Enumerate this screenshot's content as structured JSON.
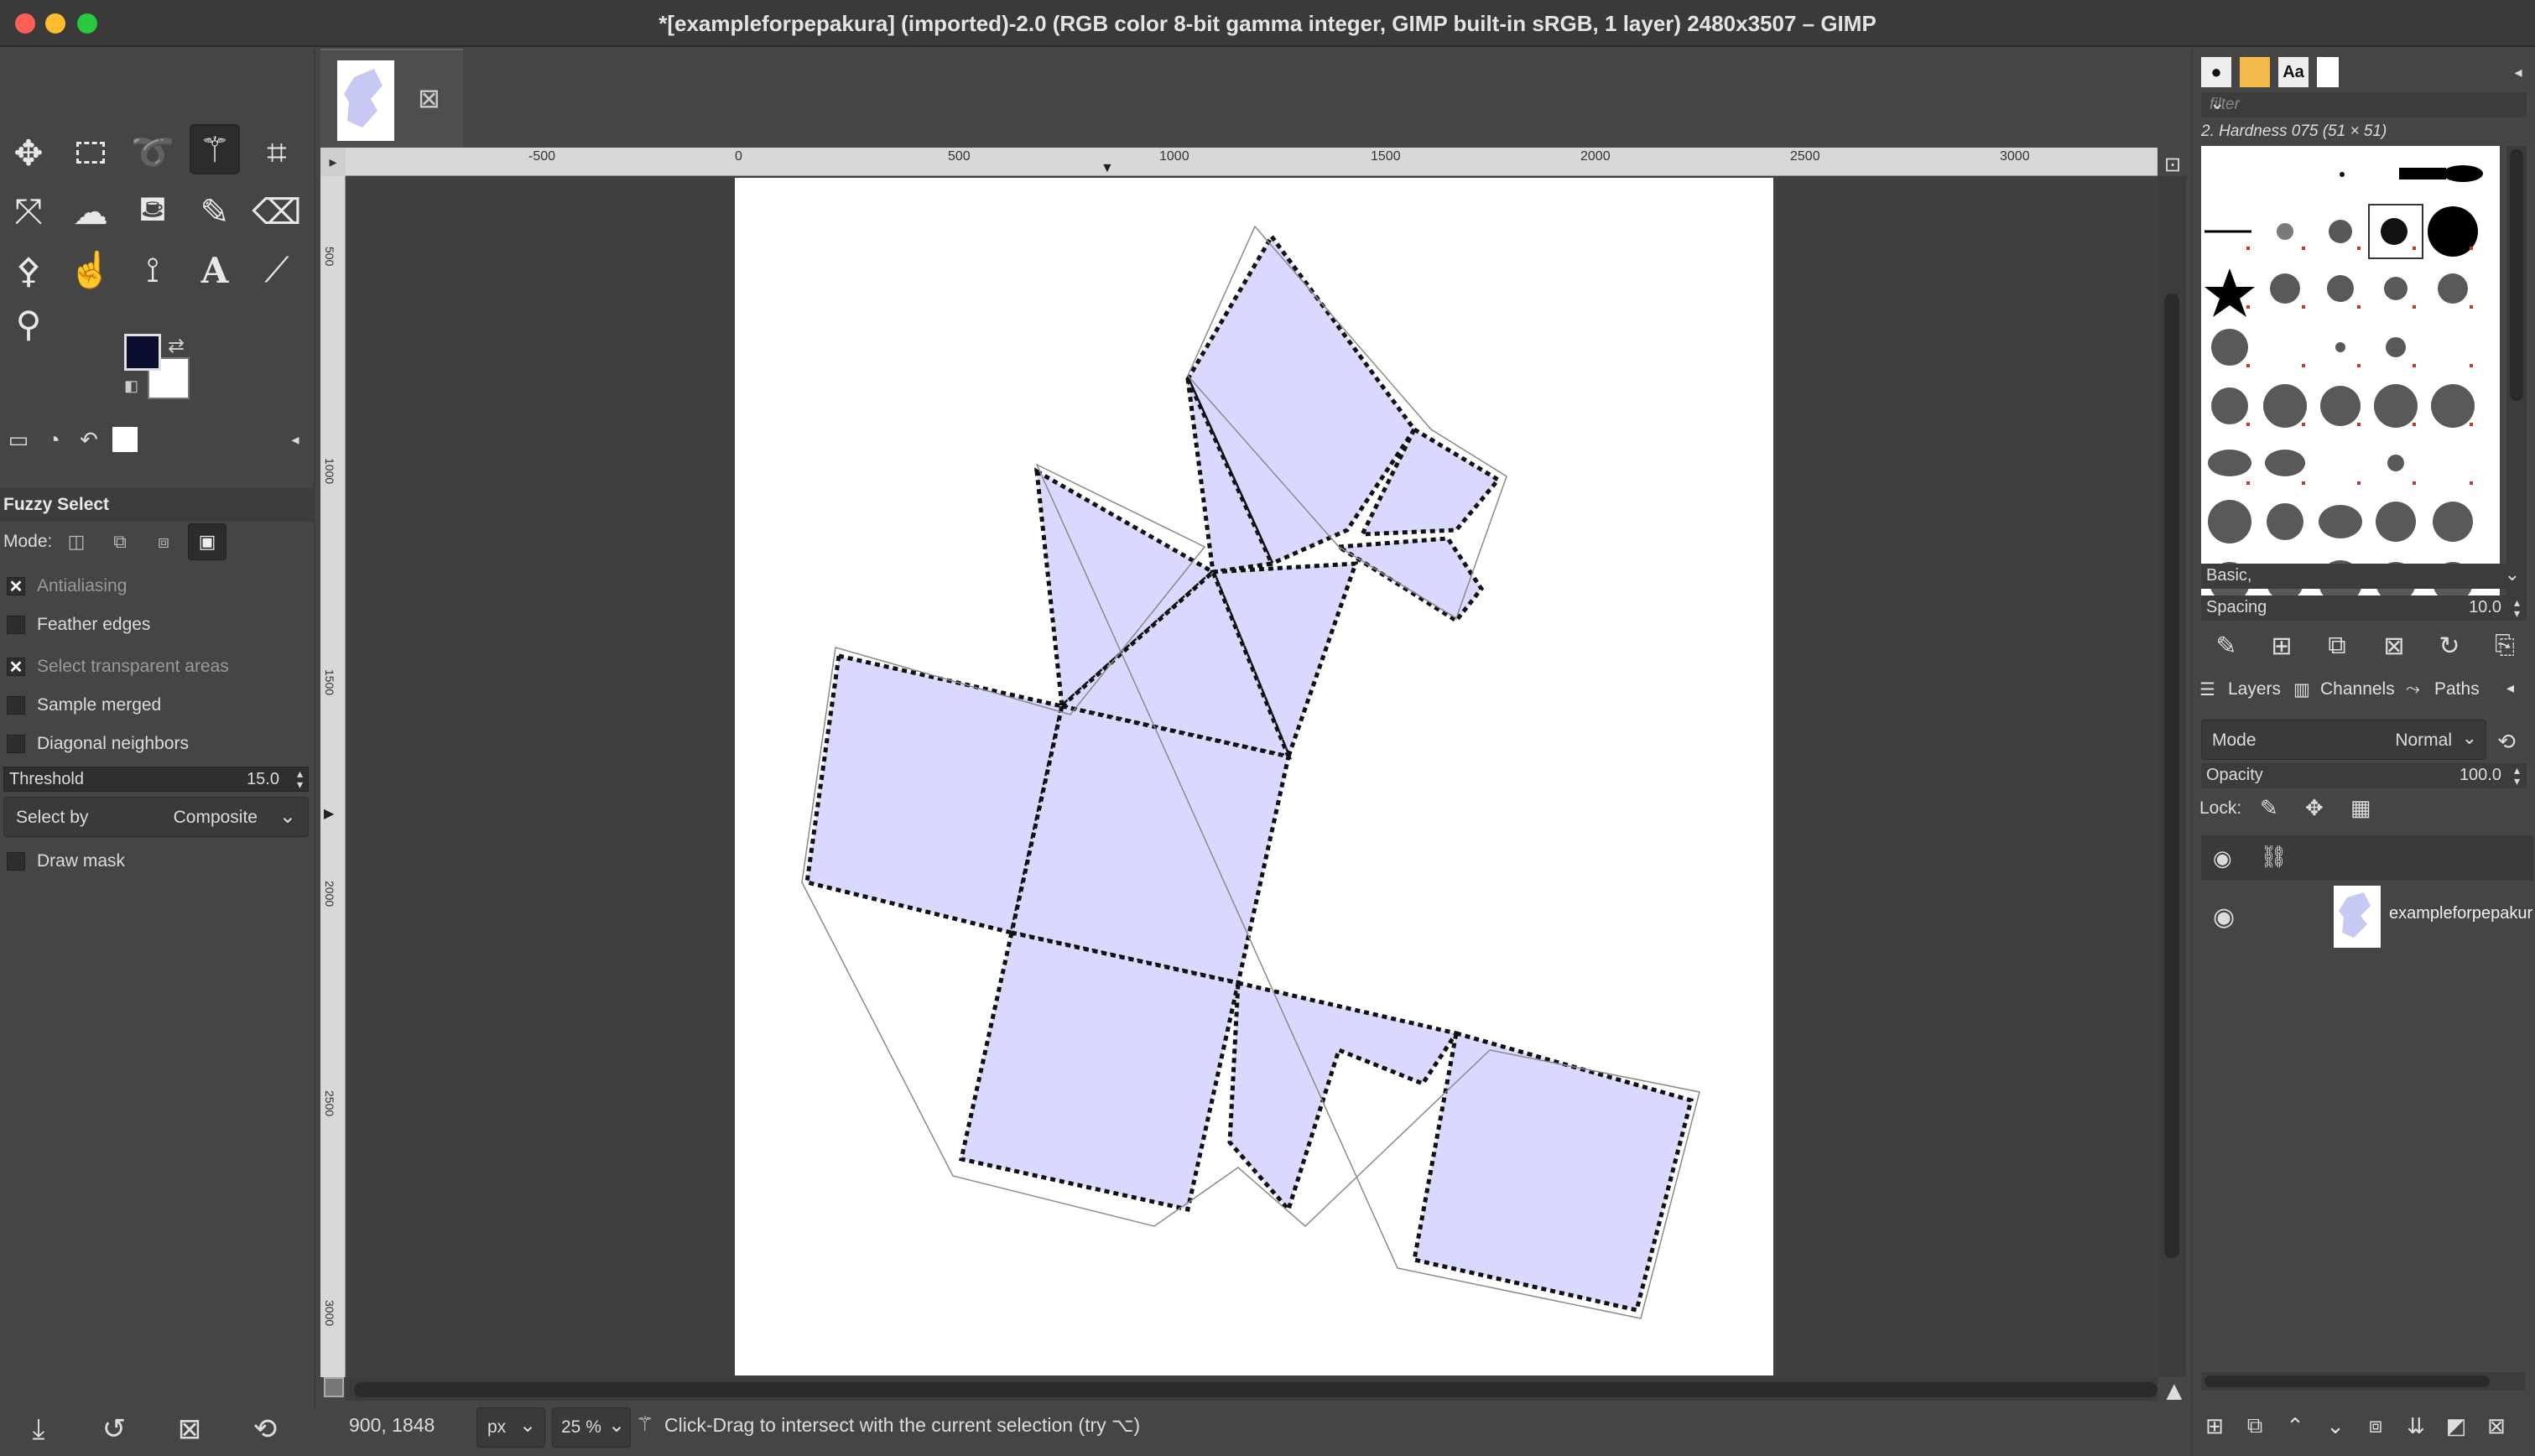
{
  "window": {
    "title": "*[exampleforpepakura] (imported)-2.0 (RGB color 8-bit gamma integer, GIMP built-in sRGB, 1 layer) 2480x3507 – GIMP"
  },
  "toolbox": {
    "tools": [
      "move-tool",
      "rect-select-tool",
      "lasso-tool",
      "fuzzy-select-tool",
      "crop-tool",
      "transform-tool",
      "warp-tool",
      "bucket-fill-tool",
      "paintbrush-tool",
      "eraser-tool",
      "clone-tool",
      "smudge-tool",
      "paths-tool",
      "text-tool",
      "color-picker-tool",
      "zoom-tool"
    ],
    "fg_color": "#0a0d2e",
    "bg_color": "#ffffff"
  },
  "tool_options": {
    "title": "Fuzzy Select",
    "mode_label": "Mode:",
    "antialiasing": "Antialiasing",
    "feather_edges": "Feather edges",
    "select_transparent": "Select transparent areas",
    "sample_merged": "Sample merged",
    "diagonal_neighbors": "Diagonal neighbors",
    "threshold_label": "Threshold",
    "threshold_value": "15.0",
    "select_by_label": "Select by",
    "select_by_value": "Composite",
    "draw_mask": "Draw mask"
  },
  "rulers": {
    "h_labels": [
      "-500",
      "0",
      "500",
      "1000",
      "1500",
      "2000",
      "2500",
      "3000"
    ],
    "v_labels": [
      "500",
      "1000",
      "1500",
      "2000",
      "2500",
      "3000"
    ]
  },
  "status": {
    "coords": "900, 1848",
    "unit": "px",
    "zoom": "25 %",
    "message": "Click-Drag to intersect with the current selection (try ⌥)"
  },
  "brushes": {
    "filter_placeholder": "filter",
    "selected_brush": "2. Hardness 075 (51 × 51)",
    "preset": "Basic,",
    "spacing_label": "Spacing",
    "spacing_value": "10.0"
  },
  "layers": {
    "tab_layers": "Layers",
    "tab_channels": "Channels",
    "tab_paths": "Paths",
    "mode_label": "Mode",
    "mode_value": "Normal",
    "opacity_label": "Opacity",
    "opacity_value": "100.0",
    "lock_label": "Lock:",
    "layer_name": "exampleforpepakura"
  },
  "colors": {
    "selection_fill": "#d9d9ff",
    "accent_dark": "#2c2c2c"
  }
}
